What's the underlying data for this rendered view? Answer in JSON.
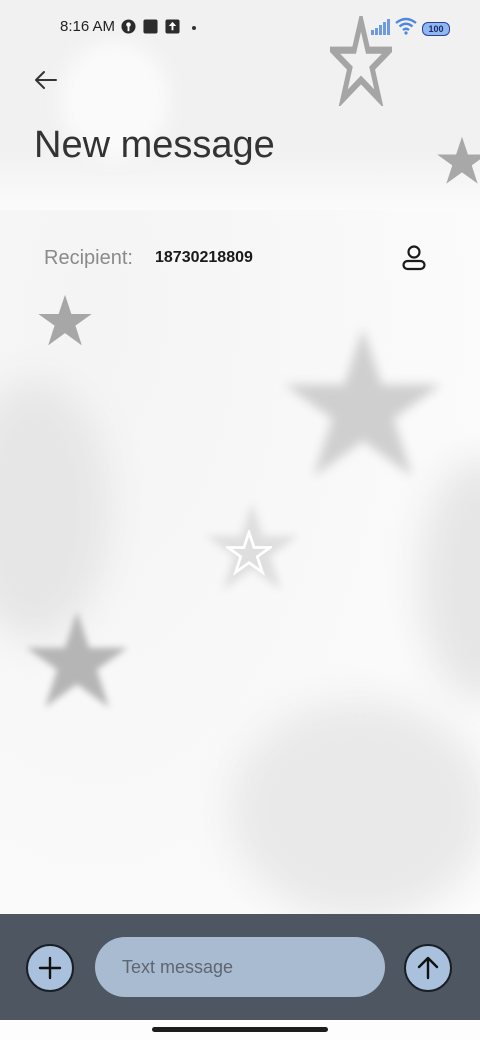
{
  "status_bar": {
    "time": "8:16 AM",
    "battery": "100",
    "icons": [
      "vpn-key-icon",
      "notification-square-icon",
      "upload-icon",
      "dot-icon",
      "cellular-signal-icon",
      "wifi-icon",
      "battery-icon"
    ]
  },
  "header": {
    "back_icon": "arrow-left-icon",
    "title": "New message"
  },
  "recipient": {
    "label": "Recipient:",
    "value": "18730218809",
    "contact_icon": "person-icon"
  },
  "composer": {
    "add_icon": "plus-icon",
    "placeholder": "Text message",
    "value": "",
    "send_icon": "arrow-up-icon"
  },
  "colors": {
    "bottom_bar": "#4e5661",
    "button_fill": "#a9c1dc",
    "input_fill": "#a9bbd0",
    "title_text": "#333333"
  }
}
